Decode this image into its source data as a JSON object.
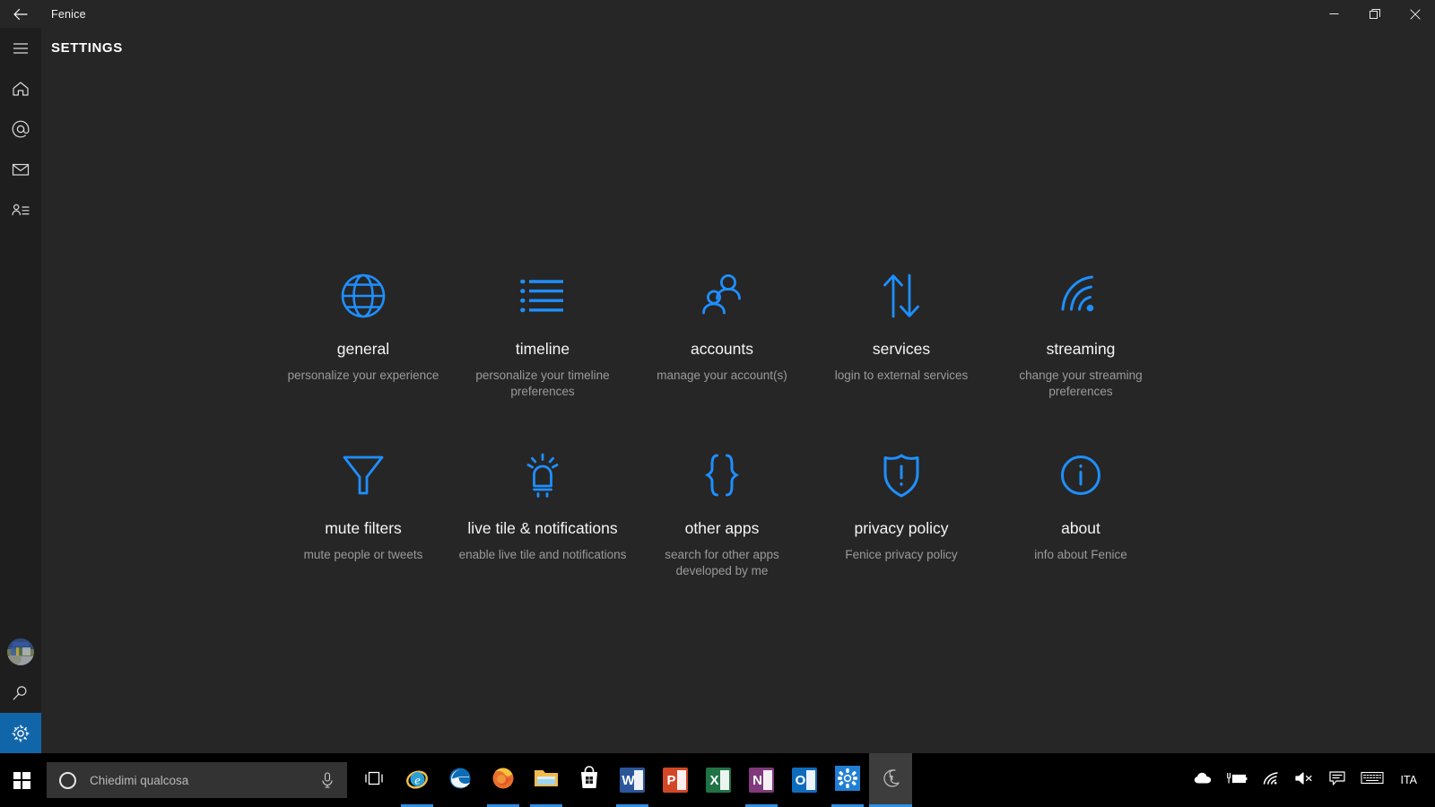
{
  "window": {
    "app_title": "Fenice",
    "back_icon": "back-arrow-icon",
    "minimize_label": "—",
    "restore_label": "❐",
    "close_label": "✕"
  },
  "header": {
    "page_title": "SETTINGS"
  },
  "colors": {
    "accent_blue": "#1e8fff",
    "background": "#262626",
    "rail_background": "#1e1e1e",
    "rail_active": "#1166aa",
    "taskbar": "#000000",
    "label_text": "#f5f5f5",
    "desc_text": "#9a9a9a"
  },
  "rail": {
    "top_items": [
      {
        "icon": "hamburger-menu-icon",
        "name": "menu"
      },
      {
        "icon": "home-icon",
        "name": "home"
      },
      {
        "icon": "at-mentions-icon",
        "name": "mentions"
      },
      {
        "icon": "mail-envelope-icon",
        "name": "messages"
      },
      {
        "icon": "person-list-icon",
        "name": "lists"
      }
    ],
    "bottom_items": [
      {
        "icon": "avatar-image",
        "name": "profile-avatar"
      },
      {
        "icon": "search-icon",
        "name": "search"
      },
      {
        "icon": "gear-icon",
        "name": "settings",
        "active": true
      }
    ]
  },
  "settings_tiles": [
    {
      "icon": "globe-icon",
      "label": "general",
      "desc": "personalize your experience"
    },
    {
      "icon": "list-bullets-icon",
      "label": "timeline",
      "desc": "personalize your timeline preferences"
    },
    {
      "icon": "people-icon",
      "label": "accounts",
      "desc": "manage your account(s)"
    },
    {
      "icon": "arrows-updown-icon",
      "label": "services",
      "desc": "login to external services"
    },
    {
      "icon": "wifi-signal-icon",
      "label": "streaming",
      "desc": "change your streaming preferences"
    },
    {
      "icon": "funnel-icon",
      "label": "mute filters",
      "desc": "mute people or tweets"
    },
    {
      "icon": "lightbulb-icon",
      "label": "live tile & notifications",
      "desc": "enable live tile and notifications"
    },
    {
      "icon": "curly-braces-icon",
      "label": "other apps",
      "desc": "search for other apps developed by me"
    },
    {
      "icon": "shield-alert-icon",
      "label": "privacy policy",
      "desc": "Fenice privacy policy"
    },
    {
      "icon": "info-circle-icon",
      "label": "about",
      "desc": "info about Fenice"
    }
  ],
  "taskbar": {
    "start_icon": "windows-logo-icon",
    "cortana_placeholder": "Chiedimi qualcosa",
    "mic_icon": "microphone-icon",
    "apps": [
      {
        "name": "task-view",
        "icon": "task-view-icon",
        "running": false,
        "active": false
      },
      {
        "name": "internet-explorer",
        "icon": "internet-explorer-icon",
        "running": true,
        "active": false
      },
      {
        "name": "microsoft-edge",
        "icon": "edge-icon",
        "running": false,
        "active": false
      },
      {
        "name": "mozilla-firefox",
        "icon": "firefox-icon",
        "running": true,
        "active": false
      },
      {
        "name": "file-explorer",
        "icon": "folder-icon",
        "running": true,
        "active": false
      },
      {
        "name": "microsoft-store",
        "icon": "store-bag-icon",
        "running": false,
        "active": false
      },
      {
        "name": "word",
        "icon": "word-icon",
        "running": true,
        "active": false
      },
      {
        "name": "powerpoint",
        "icon": "powerpoint-icon",
        "running": false,
        "active": false
      },
      {
        "name": "excel",
        "icon": "excel-icon",
        "running": false,
        "active": false
      },
      {
        "name": "onenote",
        "icon": "onenote-icon",
        "running": true,
        "active": false
      },
      {
        "name": "outlook",
        "icon": "outlook-icon",
        "running": false,
        "active": false
      },
      {
        "name": "windows-settings",
        "icon": "settings-gear-icon",
        "running": true,
        "active": false
      },
      {
        "name": "fenice",
        "icon": "fenice-icon",
        "running": true,
        "active": true
      }
    ],
    "tray": [
      {
        "name": "onedrive",
        "icon": "cloud-icon"
      },
      {
        "name": "battery",
        "icon": "battery-charging-icon"
      },
      {
        "name": "network",
        "icon": "wifi-icon"
      },
      {
        "name": "volume",
        "icon": "speaker-muted-icon"
      },
      {
        "name": "action-center",
        "icon": "chat-bubble-icon"
      },
      {
        "name": "touch-keyboard",
        "icon": "keyboard-icon"
      }
    ],
    "language": "ITA"
  }
}
